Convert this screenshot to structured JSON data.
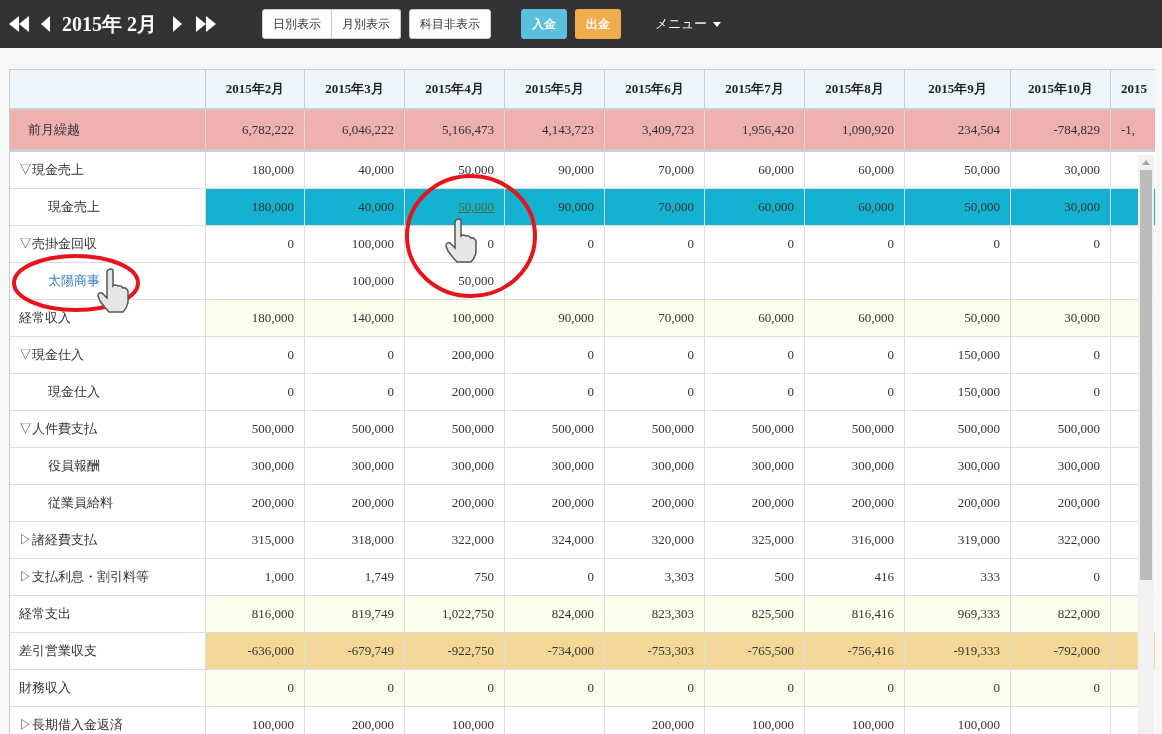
{
  "toolbar": {
    "title": "2015年 2月",
    "view_buttons": [
      "日別表示",
      "月別表示"
    ],
    "hide_button": "科目非表示",
    "deposit_button": "入金",
    "withdraw_button": "出金",
    "menu": "メニュー"
  },
  "table": {
    "columns": [
      "2015年2月",
      "2015年3月",
      "2015年4月",
      "2015年5月",
      "2015年6月",
      "2015年7月",
      "2015年8月",
      "2015年9月",
      "2015年10月",
      "2015"
    ],
    "carryover": {
      "label": "前月繰越",
      "cells": [
        "6,782,222",
        "6,046,222",
        "5,166,473",
        "4,143,723",
        "3,409,723",
        "1,956,420",
        "1,090,920",
        "234,504",
        "-784,829",
        "-1,"
      ]
    },
    "rows": [
      {
        "kind": "group",
        "label": "▽現金売上",
        "selected": false,
        "cells": [
          "180,000",
          "40,000",
          "50,000",
          "90,000",
          "70,000",
          "60,000",
          "60,000",
          "50,000",
          "30,000"
        ]
      },
      {
        "kind": "item",
        "label": "現金売上",
        "selected": true,
        "cells": [
          "180,000",
          "40,000",
          {
            "text": "50,000",
            "link": true
          },
          "90,000",
          "70,000",
          "60,000",
          "60,000",
          "50,000",
          "30,000"
        ]
      },
      {
        "kind": "group",
        "label": "▽売掛金回収",
        "selected": false,
        "cells": [
          "0",
          "100,000",
          "0",
          "0",
          "0",
          "0",
          "0",
          "0",
          "0"
        ]
      },
      {
        "kind": "link_item",
        "label": "太陽商事",
        "selected": false,
        "cells": [
          "",
          "100,000",
          "50,000",
          "",
          "",
          "",
          "",
          "",
          ""
        ]
      },
      {
        "kind": "summary",
        "label": "経常収入",
        "selected": false,
        "cells": [
          "180,000",
          "140,000",
          "100,000",
          "90,000",
          "70,000",
          "60,000",
          "60,000",
          "50,000",
          "30,000"
        ]
      },
      {
        "kind": "group",
        "label": "▽現金仕入",
        "selected": false,
        "cells": [
          "0",
          "0",
          "200,000",
          "0",
          "0",
          "0",
          "0",
          "150,000",
          "0"
        ]
      },
      {
        "kind": "item",
        "label": "現金仕入",
        "selected": false,
        "cells": [
          "0",
          "0",
          "200,000",
          "0",
          "0",
          "0",
          "0",
          "150,000",
          "0"
        ]
      },
      {
        "kind": "group",
        "label": "▽人件費支払",
        "selected": false,
        "cells": [
          "500,000",
          "500,000",
          "500,000",
          "500,000",
          "500,000",
          "500,000",
          "500,000",
          "500,000",
          "500,000"
        ]
      },
      {
        "kind": "item",
        "label": "役員報酬",
        "selected": false,
        "cells": [
          "300,000",
          "300,000",
          "300,000",
          "300,000",
          "300,000",
          "300,000",
          "300,000",
          "300,000",
          "300,000"
        ]
      },
      {
        "kind": "item",
        "label": "従業員給料",
        "selected": false,
        "cells": [
          "200,000",
          "200,000",
          "200,000",
          "200,000",
          "200,000",
          "200,000",
          "200,000",
          "200,000",
          "200,000"
        ]
      },
      {
        "kind": "group",
        "label": "▷諸経費支払",
        "selected": false,
        "cells": [
          "315,000",
          "318,000",
          "322,000",
          "324,000",
          "320,000",
          "325,000",
          "316,000",
          "319,000",
          "322,000"
        ]
      },
      {
        "kind": "group",
        "label": "▷支払利息・割引料等",
        "selected": false,
        "cells": [
          "1,000",
          "1,749",
          "750",
          "0",
          "3,303",
          "500",
          "416",
          "333",
          "0"
        ]
      },
      {
        "kind": "summary",
        "label": "経常支出",
        "selected": false,
        "cells": [
          "816,000",
          "819,749",
          "1,022,750",
          "824,000",
          "823,303",
          "825,500",
          "816,416",
          "969,333",
          "822,000"
        ]
      },
      {
        "kind": "balance",
        "label": "差引営業収支",
        "selected": false,
        "cells": [
          "-636,000",
          "-679,749",
          "-922,750",
          "-734,000",
          "-753,303",
          "-765,500",
          "-756,416",
          "-919,333",
          "-792,000"
        ]
      },
      {
        "kind": "summary",
        "label": "財務収入",
        "selected": false,
        "cells": [
          "0",
          "0",
          "0",
          "0",
          "0",
          "0",
          "0",
          "0",
          "0"
        ]
      },
      {
        "kind": "group",
        "label": "▷長期借入金返済",
        "selected": false,
        "cells": [
          "100,000",
          "200,000",
          "100,000",
          "",
          "200,000",
          "100,000",
          "100,000",
          "100,000",
          ""
        ]
      }
    ]
  },
  "annotations": [
    {
      "kind": "circle_with_cursor"
    },
    {
      "kind": "circle_with_cursor"
    }
  ]
}
